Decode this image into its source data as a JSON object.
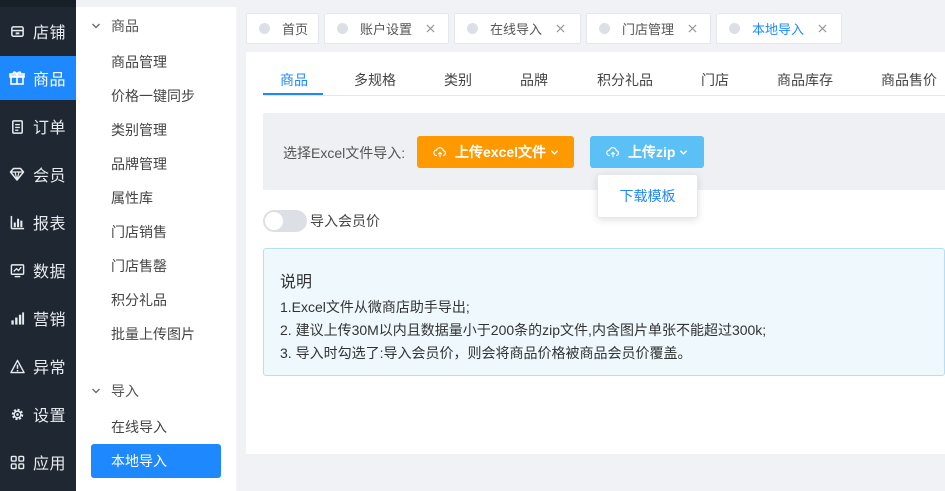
{
  "rail": {
    "items": [
      {
        "label": "店铺",
        "icon": "store-icon"
      },
      {
        "label": "商品",
        "icon": "gift-icon",
        "active": true
      },
      {
        "label": "订单",
        "icon": "clipboard-icon"
      },
      {
        "label": "会员",
        "icon": "diamond-icon"
      },
      {
        "label": "报表",
        "icon": "bar-chart-icon"
      },
      {
        "label": "数据",
        "icon": "monitor-chart-icon"
      },
      {
        "label": "营销",
        "icon": "signal-bars-icon"
      },
      {
        "label": "异常",
        "icon": "warning-icon"
      },
      {
        "label": "设置",
        "icon": "gear-icon"
      },
      {
        "label": "应用",
        "icon": "apps-grid-icon"
      }
    ]
  },
  "submenu": {
    "group1": {
      "title": "商品",
      "items": [
        "商品管理",
        "价格一键同步",
        "类别管理",
        "品牌管理",
        "属性库",
        "门店销售",
        "门店售罄",
        "积分礼品",
        "批量上传图片"
      ]
    },
    "group2": {
      "title": "导入",
      "items": [
        "在线导入",
        "本地导入"
      ]
    }
  },
  "page_tabs": [
    {
      "label": "首页",
      "closable": false
    },
    {
      "label": "账户设置",
      "closable": true
    },
    {
      "label": "在线导入",
      "closable": true
    },
    {
      "label": "门店管理",
      "closable": true
    },
    {
      "label": "本地导入",
      "closable": true,
      "active": true
    }
  ],
  "content_tabs": [
    "商品",
    "多规格",
    "类别",
    "品牌",
    "积分礼品",
    "门店",
    "商品库存",
    "商品售价"
  ],
  "upload": {
    "label": "选择Excel文件导入:",
    "excel_button": "上传excel文件",
    "zip_button": "上传zip",
    "dropdown_item": "下载模板"
  },
  "member_price_switch": {
    "label": "导入会员价",
    "on": false
  },
  "notice": {
    "title": "说明",
    "lines": [
      "1.Excel文件从微商店助手导出;",
      "2. 建议上传30M以内且数据量小于200条的zip文件,内含图片单张不能超过300k;",
      "3. 导入时勾选了:导入会员价，则会将商品价格被商品会员价覆盖。"
    ]
  },
  "colors": {
    "primary": "#1e88ff",
    "excel_button": "#ff9900",
    "zip_button": "#5bc0f5",
    "rail_bg": "#1f2733"
  }
}
